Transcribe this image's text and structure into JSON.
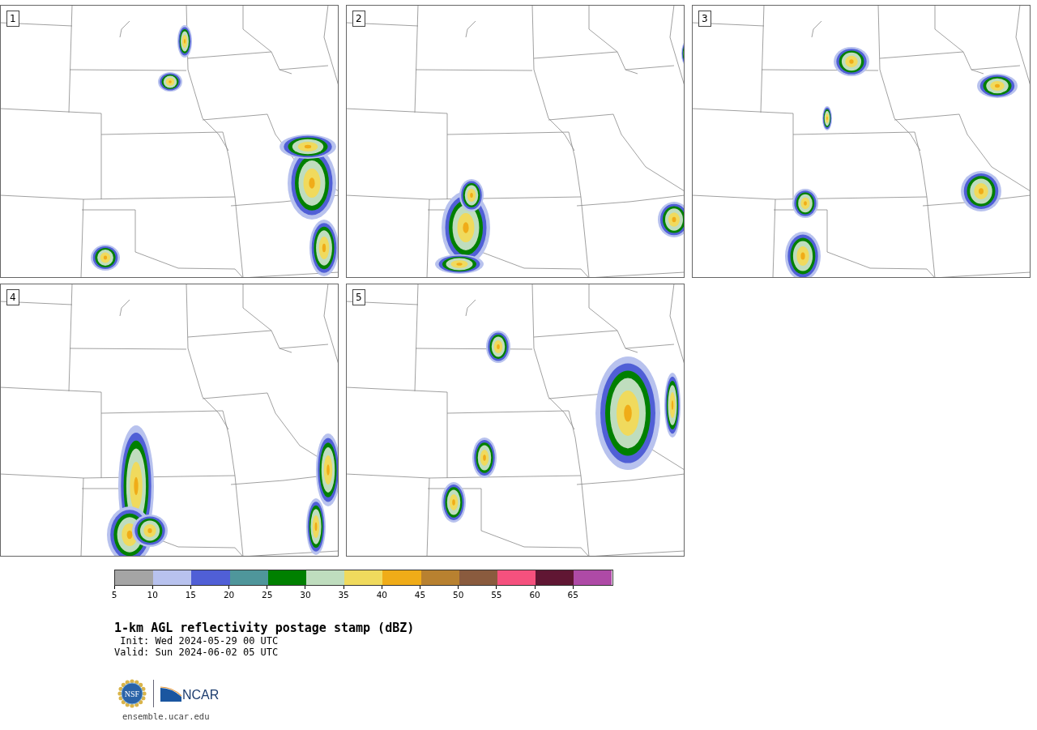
{
  "panels": [
    {
      "label": "1"
    },
    {
      "label": "2"
    },
    {
      "label": "3"
    },
    {
      "label": "4"
    },
    {
      "label": "5"
    }
  ],
  "colorbar": {
    "bins": [
      {
        "color": "#a5a5a5"
      },
      {
        "color": "#b8c2ee"
      },
      {
        "color": "#505fd6"
      },
      {
        "color": "#4f969b"
      },
      {
        "color": "#008000"
      },
      {
        "color": "#bfddbe"
      },
      {
        "color": "#f0da5d"
      },
      {
        "color": "#f0ac18"
      },
      {
        "color": "#b88130"
      },
      {
        "color": "#8a5b3e"
      },
      {
        "color": "#f5517e"
      },
      {
        "color": "#601633"
      },
      {
        "color": "#ae4aa6"
      }
    ],
    "ticks": [
      "5",
      "10",
      "15",
      "20",
      "25",
      "30",
      "35",
      "40",
      "45",
      "50",
      "55",
      "60",
      "65"
    ]
  },
  "title": "1-km AGL reflectivity postage stamp (dBZ)",
  "init": " Init: Wed 2024-05-29 00 UTC",
  "valid": "Valid: Sun 2024-06-02 05 UTC",
  "logos": {
    "seal": "NSF",
    "wordmark": "NCAR"
  },
  "footer": "ensemble.ucar.edu"
}
